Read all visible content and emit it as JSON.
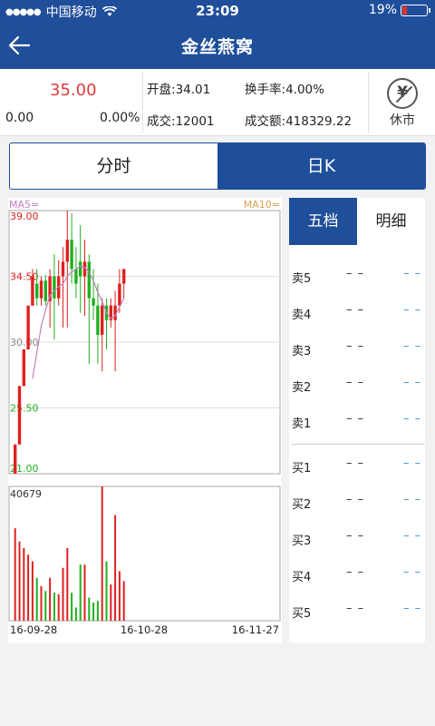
{
  "status_bar": {
    "carrier": "中国移动",
    "signal": "●●●●●",
    "time": "23:09",
    "battery": "19%",
    "battery_level": 0.19
  },
  "nav": {
    "title": "金丝燕窝"
  },
  "quote": {
    "price": "35.00",
    "change": "0.00",
    "change_pct": "0.00%",
    "open_label": "开盘:",
    "open": "34.01",
    "turnover_rate_label": "换手率:",
    "turnover_rate": "4.00%",
    "volume_label": "成交:",
    "volume": "12001",
    "amount_label": "成交额:",
    "amount": "418329.22",
    "halt_icon_char": "¥",
    "halt_label": "休市"
  },
  "chart_tabs": [
    {
      "label": "分时",
      "active": false
    },
    {
      "label": "日K",
      "active": true
    }
  ],
  "colors": {
    "brand": "#1f4e9a",
    "up": "#e02020",
    "down": "#20b020",
    "ma5": "#c080c0",
    "ma10": "#d8a050",
    "book_value": "#3a9be8"
  },
  "chart": {
    "ma5_label": "MA5=",
    "ma10_label": "MA10=",
    "y_labels": [
      "39.00",
      "34.50",
      "30.00",
      "25.50",
      "21.00"
    ],
    "volume_max_label": "40679",
    "x_labels": [
      "16-09-28",
      "16-10-28",
      "16-11-27"
    ]
  },
  "chart_data": {
    "type": "candlestick",
    "ylim": [
      21.0,
      39.0
    ],
    "y_ticks": [
      39.0,
      34.5,
      30.0,
      25.5,
      21.0
    ],
    "volume_max": 40679,
    "x_ticks": [
      "16-09-28",
      "16-10-28",
      "16-11-27"
    ],
    "candles": [
      {
        "o": 21.0,
        "h": 23.0,
        "l": 21.0,
        "c": 23.0,
        "v": 28000
      },
      {
        "o": 23.0,
        "h": 27.0,
        "l": 23.0,
        "c": 27.0,
        "v": 24000
      },
      {
        "o": 27.0,
        "h": 29.5,
        "l": 27.0,
        "c": 29.5,
        "v": 22000
      },
      {
        "o": 29.5,
        "h": 32.5,
        "l": 29.5,
        "c": 32.5,
        "v": 20000
      },
      {
        "o": 32.5,
        "h": 35.0,
        "l": 32.5,
        "c": 34.5,
        "v": 18000
      },
      {
        "o": 34.0,
        "h": 35.0,
        "l": 32.5,
        "c": 33.0,
        "v": 13000
      },
      {
        "o": 33.0,
        "h": 34.5,
        "l": 32.5,
        "c": 34.2,
        "v": 10500
      },
      {
        "o": 34.2,
        "h": 34.6,
        "l": 32.5,
        "c": 32.8,
        "v": 9000
      },
      {
        "o": 32.8,
        "h": 35.0,
        "l": 31.0,
        "c": 34.5,
        "v": 13000
      },
      {
        "o": 34.5,
        "h": 36.0,
        "l": 30.2,
        "c": 33.0,
        "v": 8500
      },
      {
        "o": 33.0,
        "h": 35.6,
        "l": 32.5,
        "c": 34.5,
        "v": 8000
      },
      {
        "o": 34.5,
        "h": 36.5,
        "l": 31.0,
        "c": 35.5,
        "v": 16000
      },
      {
        "o": 35.5,
        "h": 39.0,
        "l": 31.0,
        "c": 37.0,
        "v": 22000
      },
      {
        "o": 37.0,
        "h": 38.8,
        "l": 34.0,
        "c": 35.0,
        "v": 8500
      },
      {
        "o": 35.0,
        "h": 36.5,
        "l": 33.0,
        "c": 34.0,
        "v": 4000
      },
      {
        "o": 35.5,
        "h": 38.0,
        "l": 32.0,
        "c": 34.5,
        "v": 17000
      },
      {
        "o": 34.5,
        "h": 37.0,
        "l": 31.8,
        "c": 35.5,
        "v": 17000
      },
      {
        "o": 35.5,
        "h": 36.0,
        "l": 28.5,
        "c": 33.0,
        "v": 7000
      },
      {
        "o": 33.0,
        "h": 35.0,
        "l": 31.5,
        "c": 32.5,
        "v": 5500
      },
      {
        "o": 32.5,
        "h": 34.0,
        "l": 28.5,
        "c": 30.5,
        "v": 6000
      },
      {
        "o": 30.5,
        "h": 33.0,
        "l": 28.0,
        "c": 32.5,
        "v": 40679
      },
      {
        "o": 32.5,
        "h": 33.0,
        "l": 29.5,
        "c": 31.5,
        "v": 18000
      },
      {
        "o": 31.5,
        "h": 33.0,
        "l": 31.0,
        "c": 32.5,
        "v": 11000
      },
      {
        "o": 31.5,
        "h": 33.5,
        "l": 28.0,
        "c": 32.5,
        "v": 32000
      },
      {
        "o": 32.5,
        "h": 35.0,
        "l": 32.0,
        "c": 34.0,
        "v": 15000
      },
      {
        "o": 34.0,
        "h": 35.0,
        "l": 33.0,
        "c": 35.0,
        "v": 12000
      }
    ],
    "ma5": [
      null,
      null,
      null,
      null,
      27.5,
      29.3,
      31.1,
      32.2,
      33.2,
      33.5,
      33.8,
      34.0,
      34.5,
      34.8,
      35.0,
      35.2,
      35.1,
      34.8,
      34.2,
      33.4,
      32.8,
      32.0,
      31.6,
      31.8,
      32.4,
      33.0
    ]
  },
  "order_book": {
    "tabs": [
      {
        "label": "五档",
        "active": true
      },
      {
        "label": "明细",
        "active": false
      }
    ],
    "rows": [
      {
        "label": "卖5",
        "price": "– –",
        "vol": "– –"
      },
      {
        "label": "卖4",
        "price": "– –",
        "vol": "– –"
      },
      {
        "label": "卖3",
        "price": "– –",
        "vol": "– –"
      },
      {
        "label": "卖2",
        "price": "– –",
        "vol": "– –"
      },
      {
        "label": "卖1",
        "price": "– –",
        "vol": "– –"
      },
      {
        "label": "买1",
        "price": "– –",
        "vol": "– –"
      },
      {
        "label": "买2",
        "price": "– –",
        "vol": "– –"
      },
      {
        "label": "买3",
        "price": "– –",
        "vol": "– –"
      },
      {
        "label": "买4",
        "price": "– –",
        "vol": "– –"
      },
      {
        "label": "买5",
        "price": "– –",
        "vol": "– –"
      }
    ]
  }
}
